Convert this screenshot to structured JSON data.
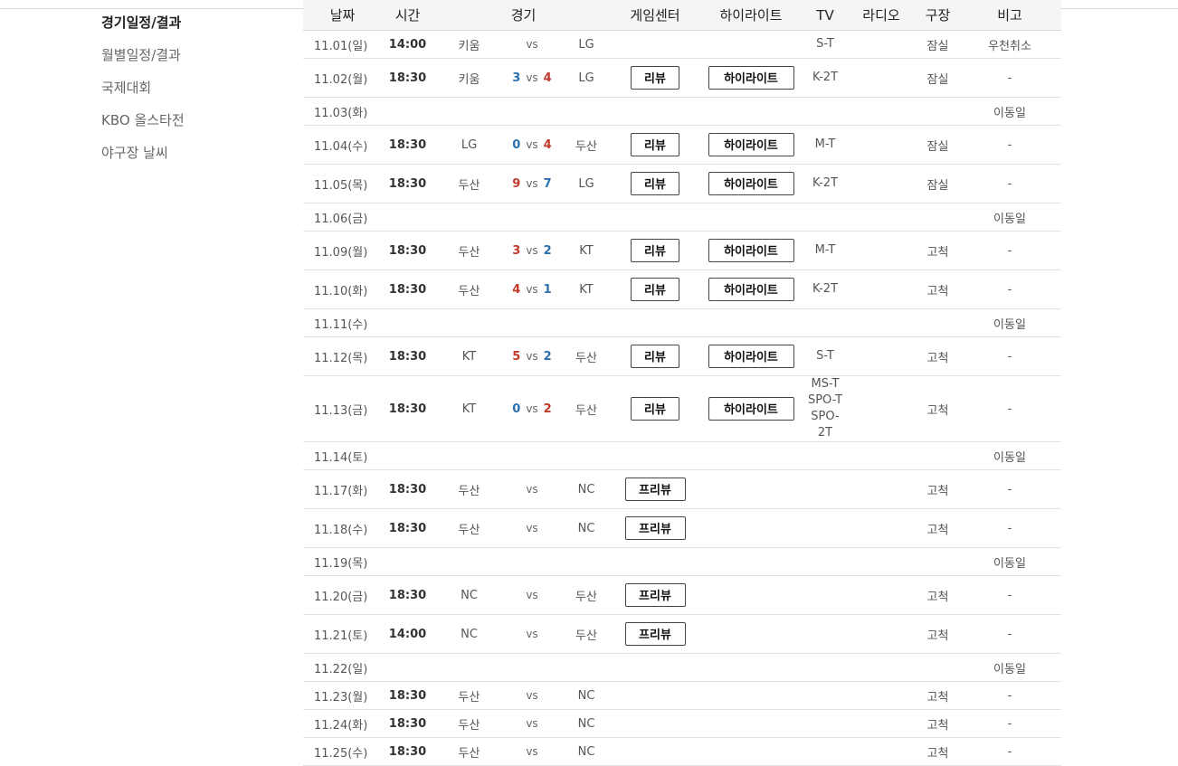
{
  "sidebar": {
    "items": [
      {
        "label": "경기일정/결과",
        "active": true
      },
      {
        "label": "월별일정/결과",
        "active": false
      },
      {
        "label": "국제대회",
        "active": false
      },
      {
        "label": "KBO 올스타전",
        "active": false
      },
      {
        "label": "야구장 날씨",
        "active": false
      }
    ]
  },
  "table": {
    "headers": [
      "날짜",
      "시간",
      "경기",
      "게임센터",
      "하이라이트",
      "TV",
      "라디오",
      "구장",
      "비고"
    ],
    "rows": [
      {
        "date": "11.01(일)",
        "time": "14:00",
        "away": "키움",
        "away_score": "",
        "vs": "vs",
        "home_score": "",
        "home": "LG",
        "gc": "",
        "hl": "",
        "tv": [
          "S-T"
        ],
        "radio": "",
        "stadium": "잠실",
        "note": "우천취소",
        "height": 30
      },
      {
        "date": "11.02(월)",
        "time": "18:30",
        "away": "키움",
        "away_score": "3",
        "vs": "vs",
        "home_score": "4",
        "home": "LG",
        "gc": "리뷰",
        "hl": "하이라이트",
        "tv": [
          "K-2T"
        ],
        "radio": "",
        "stadium": "잠실",
        "note": "-",
        "height": 42
      },
      {
        "date": "11.03(화)",
        "time": "",
        "away": "",
        "away_score": "",
        "vs": "",
        "home_score": "",
        "home": "",
        "gc": "",
        "hl": "",
        "tv": [],
        "radio": "",
        "stadium": "",
        "note": "이동일",
        "height": 30
      },
      {
        "date": "11.04(수)",
        "time": "18:30",
        "away": "LG",
        "away_score": "0",
        "vs": "vs",
        "home_score": "4",
        "home": "두산",
        "gc": "리뷰",
        "hl": "하이라이트",
        "tv": [
          "M-T"
        ],
        "radio": "",
        "stadium": "잠실",
        "note": "-",
        "height": 42
      },
      {
        "date": "11.05(목)",
        "time": "18:30",
        "away": "두산",
        "away_score": "9",
        "vs": "vs",
        "home_score": "7",
        "home": "LG",
        "gc": "리뷰",
        "hl": "하이라이트",
        "tv": [
          "K-2T"
        ],
        "radio": "",
        "stadium": "잠실",
        "note": "-",
        "height": 42
      },
      {
        "date": "11.06(금)",
        "time": "",
        "away": "",
        "away_score": "",
        "vs": "",
        "home_score": "",
        "home": "",
        "gc": "",
        "hl": "",
        "tv": [],
        "radio": "",
        "stadium": "",
        "note": "이동일",
        "height": 30
      },
      {
        "date": "11.09(월)",
        "time": "18:30",
        "away": "두산",
        "away_score": "3",
        "vs": "vs",
        "home_score": "2",
        "home": "KT",
        "gc": "리뷰",
        "hl": "하이라이트",
        "tv": [
          "M-T"
        ],
        "radio": "",
        "stadium": "고척",
        "note": "-",
        "height": 42
      },
      {
        "date": "11.10(화)",
        "time": "18:30",
        "away": "두산",
        "away_score": "4",
        "vs": "vs",
        "home_score": "1",
        "home": "KT",
        "gc": "리뷰",
        "hl": "하이라이트",
        "tv": [
          "K-2T"
        ],
        "radio": "",
        "stadium": "고척",
        "note": "-",
        "height": 42
      },
      {
        "date": "11.11(수)",
        "time": "",
        "away": "",
        "away_score": "",
        "vs": "",
        "home_score": "",
        "home": "",
        "gc": "",
        "hl": "",
        "tv": [],
        "radio": "",
        "stadium": "",
        "note": "이동일",
        "height": 30
      },
      {
        "date": "11.12(목)",
        "time": "18:30",
        "away": "KT",
        "away_score": "5",
        "vs": "vs",
        "home_score": "2",
        "home": "두산",
        "gc": "리뷰",
        "hl": "하이라이트",
        "tv": [
          "S-T"
        ],
        "radio": "",
        "stadium": "고척",
        "note": "-",
        "height": 42
      },
      {
        "date": "11.13(금)",
        "time": "18:30",
        "away": "KT",
        "away_score": "0",
        "vs": "vs",
        "home_score": "2",
        "home": "두산",
        "gc": "리뷰",
        "hl": "하이라이트",
        "tv": [
          "MS-T",
          "SPO-T",
          "SPO-2T"
        ],
        "radio": "",
        "stadium": "고척",
        "note": "-",
        "height": 66
      },
      {
        "date": "11.14(토)",
        "time": "",
        "away": "",
        "away_score": "",
        "vs": "",
        "home_score": "",
        "home": "",
        "gc": "",
        "hl": "",
        "tv": [],
        "radio": "",
        "stadium": "",
        "note": "이동일",
        "height": 30
      },
      {
        "date": "11.17(화)",
        "time": "18:30",
        "away": "두산",
        "away_score": "",
        "vs": "vs",
        "home_score": "",
        "home": "NC",
        "gc": "프리뷰",
        "hl": "",
        "tv": [],
        "radio": "",
        "stadium": "고척",
        "note": "-",
        "height": 42
      },
      {
        "date": "11.18(수)",
        "time": "18:30",
        "away": "두산",
        "away_score": "",
        "vs": "vs",
        "home_score": "",
        "home": "NC",
        "gc": "프리뷰",
        "hl": "",
        "tv": [],
        "radio": "",
        "stadium": "고척",
        "note": "-",
        "height": 42
      },
      {
        "date": "11.19(목)",
        "time": "",
        "away": "",
        "away_score": "",
        "vs": "",
        "home_score": "",
        "home": "",
        "gc": "",
        "hl": "",
        "tv": [],
        "radio": "",
        "stadium": "",
        "note": "이동일",
        "height": 30
      },
      {
        "date": "11.20(금)",
        "time": "18:30",
        "away": "NC",
        "away_score": "",
        "vs": "vs",
        "home_score": "",
        "home": "두산",
        "gc": "프리뷰",
        "hl": "",
        "tv": [],
        "radio": "",
        "stadium": "고척",
        "note": "-",
        "height": 42
      },
      {
        "date": "11.21(토)",
        "time": "14:00",
        "away": "NC",
        "away_score": "",
        "vs": "vs",
        "home_score": "",
        "home": "두산",
        "gc": "프리뷰",
        "hl": "",
        "tv": [],
        "radio": "",
        "stadium": "고척",
        "note": "-",
        "height": 42
      },
      {
        "date": "11.22(일)",
        "time": "",
        "away": "",
        "away_score": "",
        "vs": "",
        "home_score": "",
        "home": "",
        "gc": "",
        "hl": "",
        "tv": [],
        "radio": "",
        "stadium": "",
        "note": "이동일",
        "height": 30
      },
      {
        "date": "11.23(월)",
        "time": "18:30",
        "away": "두산",
        "away_score": "",
        "vs": "vs",
        "home_score": "",
        "home": "NC",
        "gc": "",
        "hl": "",
        "tv": [],
        "radio": "",
        "stadium": "고척",
        "note": "-",
        "height": 30
      },
      {
        "date": "11.24(화)",
        "time": "18:30",
        "away": "두산",
        "away_score": "",
        "vs": "vs",
        "home_score": "",
        "home": "NC",
        "gc": "",
        "hl": "",
        "tv": [],
        "radio": "",
        "stadium": "고척",
        "note": "-",
        "height": 30
      },
      {
        "date": "11.25(수)",
        "time": "18:30",
        "away": "두산",
        "away_score": "",
        "vs": "vs",
        "home_score": "",
        "home": "NC",
        "gc": "",
        "hl": "",
        "tv": [],
        "radio": "",
        "stadium": "고척",
        "note": "-",
        "height": 30
      }
    ]
  },
  "colors": {
    "win": "#c0392b",
    "lose": "#2c6fae"
  },
  "cursor_icon": "text-cursor-icon"
}
